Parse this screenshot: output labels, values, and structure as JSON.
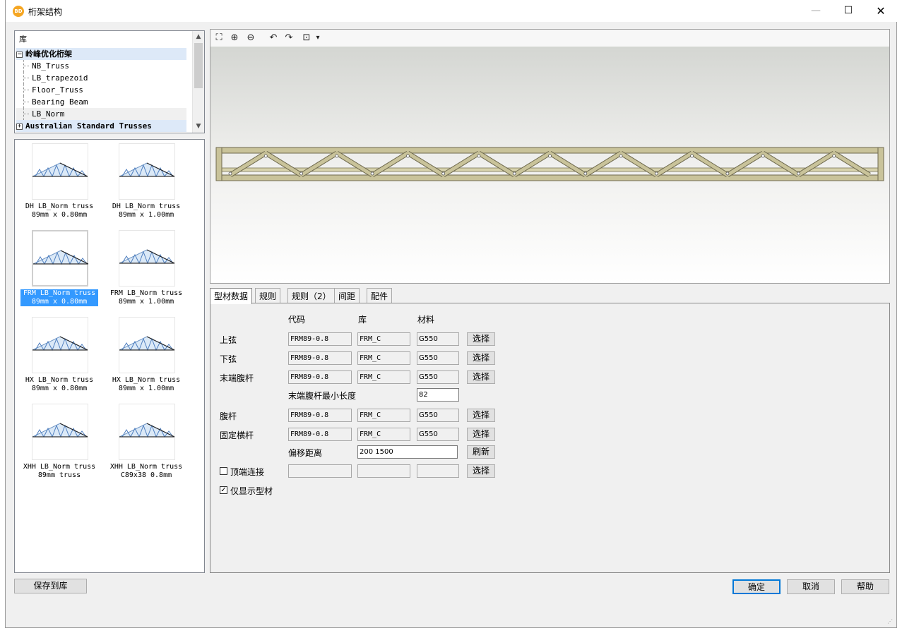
{
  "window": {
    "title": "桁架结构",
    "app_icon": "app-logo-icon",
    "controls": {
      "minimize": "—",
      "maximize": "☐",
      "close": "✕"
    }
  },
  "library_tree": {
    "header": "库",
    "groups": [
      {
        "label": "岭峰优化桁架",
        "expanded": true,
        "children": [
          "NB_Truss",
          "LB_trapezoid",
          "Floor_Truss",
          "Bearing Beam",
          "LB_Norm"
        ]
      },
      {
        "label": "Australian Standard Trusses",
        "expanded": false
      }
    ],
    "expander_open": "−",
    "expander_closed": "+"
  },
  "thumbnails": [
    {
      "line1": "DH LB_Norm truss",
      "line2": "89mm x 0.80mm"
    },
    {
      "line1": "DH LB_Norm truss",
      "line2": "89mm x 1.00mm"
    },
    {
      "line1": "FRM LB_Norm truss",
      "line2": "89mm x 0.80mm",
      "selected": true
    },
    {
      "line1": "FRM LB_Norm truss",
      "line2": "89mm x 1.00mm"
    },
    {
      "line1": "HX LB_Norm truss",
      "line2": "89mm x 0.80mm"
    },
    {
      "line1": "HX LB_Norm truss",
      "line2": "89mm x 1.00mm"
    },
    {
      "line1": "XHH LB_Norm truss",
      "line2": "89mm truss"
    },
    {
      "line1": "XHH LB_Norm truss",
      "line2": "C89x38 0.8mm"
    }
  ],
  "save_to_library": "保存到库",
  "view_toolbar": [
    {
      "name": "zoom-extents-icon",
      "glyph": "⛶"
    },
    {
      "name": "zoom-in-icon",
      "glyph": "⊕"
    },
    {
      "name": "zoom-out-icon",
      "glyph": "⊖"
    },
    {
      "name": "rotate-left-icon",
      "glyph": "↶"
    },
    {
      "name": "rotate-right-icon",
      "glyph": "↷"
    },
    {
      "name": "view-mode-icon",
      "glyph": "⊡"
    },
    {
      "name": "view-dropdown-icon",
      "glyph": "▾"
    }
  ],
  "tabs": [
    "型材数据",
    "规则",
    "规则（2）",
    "间距",
    "配件"
  ],
  "active_tab": 0,
  "form": {
    "columns": {
      "code": "代码",
      "library": "库",
      "material": "材料"
    },
    "rows": [
      {
        "label": "上弦",
        "code": "FRM89-0.8",
        "library": "FRM_C",
        "material": "G550",
        "button": "选择"
      },
      {
        "label": "下弦",
        "code": "FRM89-0.8",
        "library": "FRM_C",
        "material": "G550",
        "button": "选择"
      },
      {
        "label": "末端腹杆",
        "code": "FRM89-0.8",
        "library": "FRM_C",
        "material": "G550",
        "button": "选择"
      },
      {
        "label": "腹杆",
        "code": "FRM89-0.8",
        "library": "FRM_C",
        "material": "G550",
        "button": "选择"
      },
      {
        "label": "固定横杆",
        "code": "FRM89-0.8",
        "library": "FRM_C",
        "material": "G550",
        "button": "选择"
      }
    ],
    "min_end_web": {
      "label": "末端腹杆最小长度",
      "value": "82"
    },
    "offset": {
      "label": "偏移距离",
      "value": "200 1500",
      "button": "刷新"
    },
    "top_connect": {
      "label": "顶端连接",
      "checked": false,
      "code": "",
      "library": "",
      "material": "",
      "button": "选择"
    },
    "show_only": {
      "label": "仅显示型材",
      "checked": true,
      "check_glyph": "✓"
    }
  },
  "dialog_buttons": {
    "ok": "确定",
    "cancel": "取消",
    "help": "帮助"
  },
  "colors": {
    "accent": "#0078d7",
    "selection": "#3399ff",
    "truss": "#c9c39a",
    "tree_selected": "#dde9f8"
  }
}
